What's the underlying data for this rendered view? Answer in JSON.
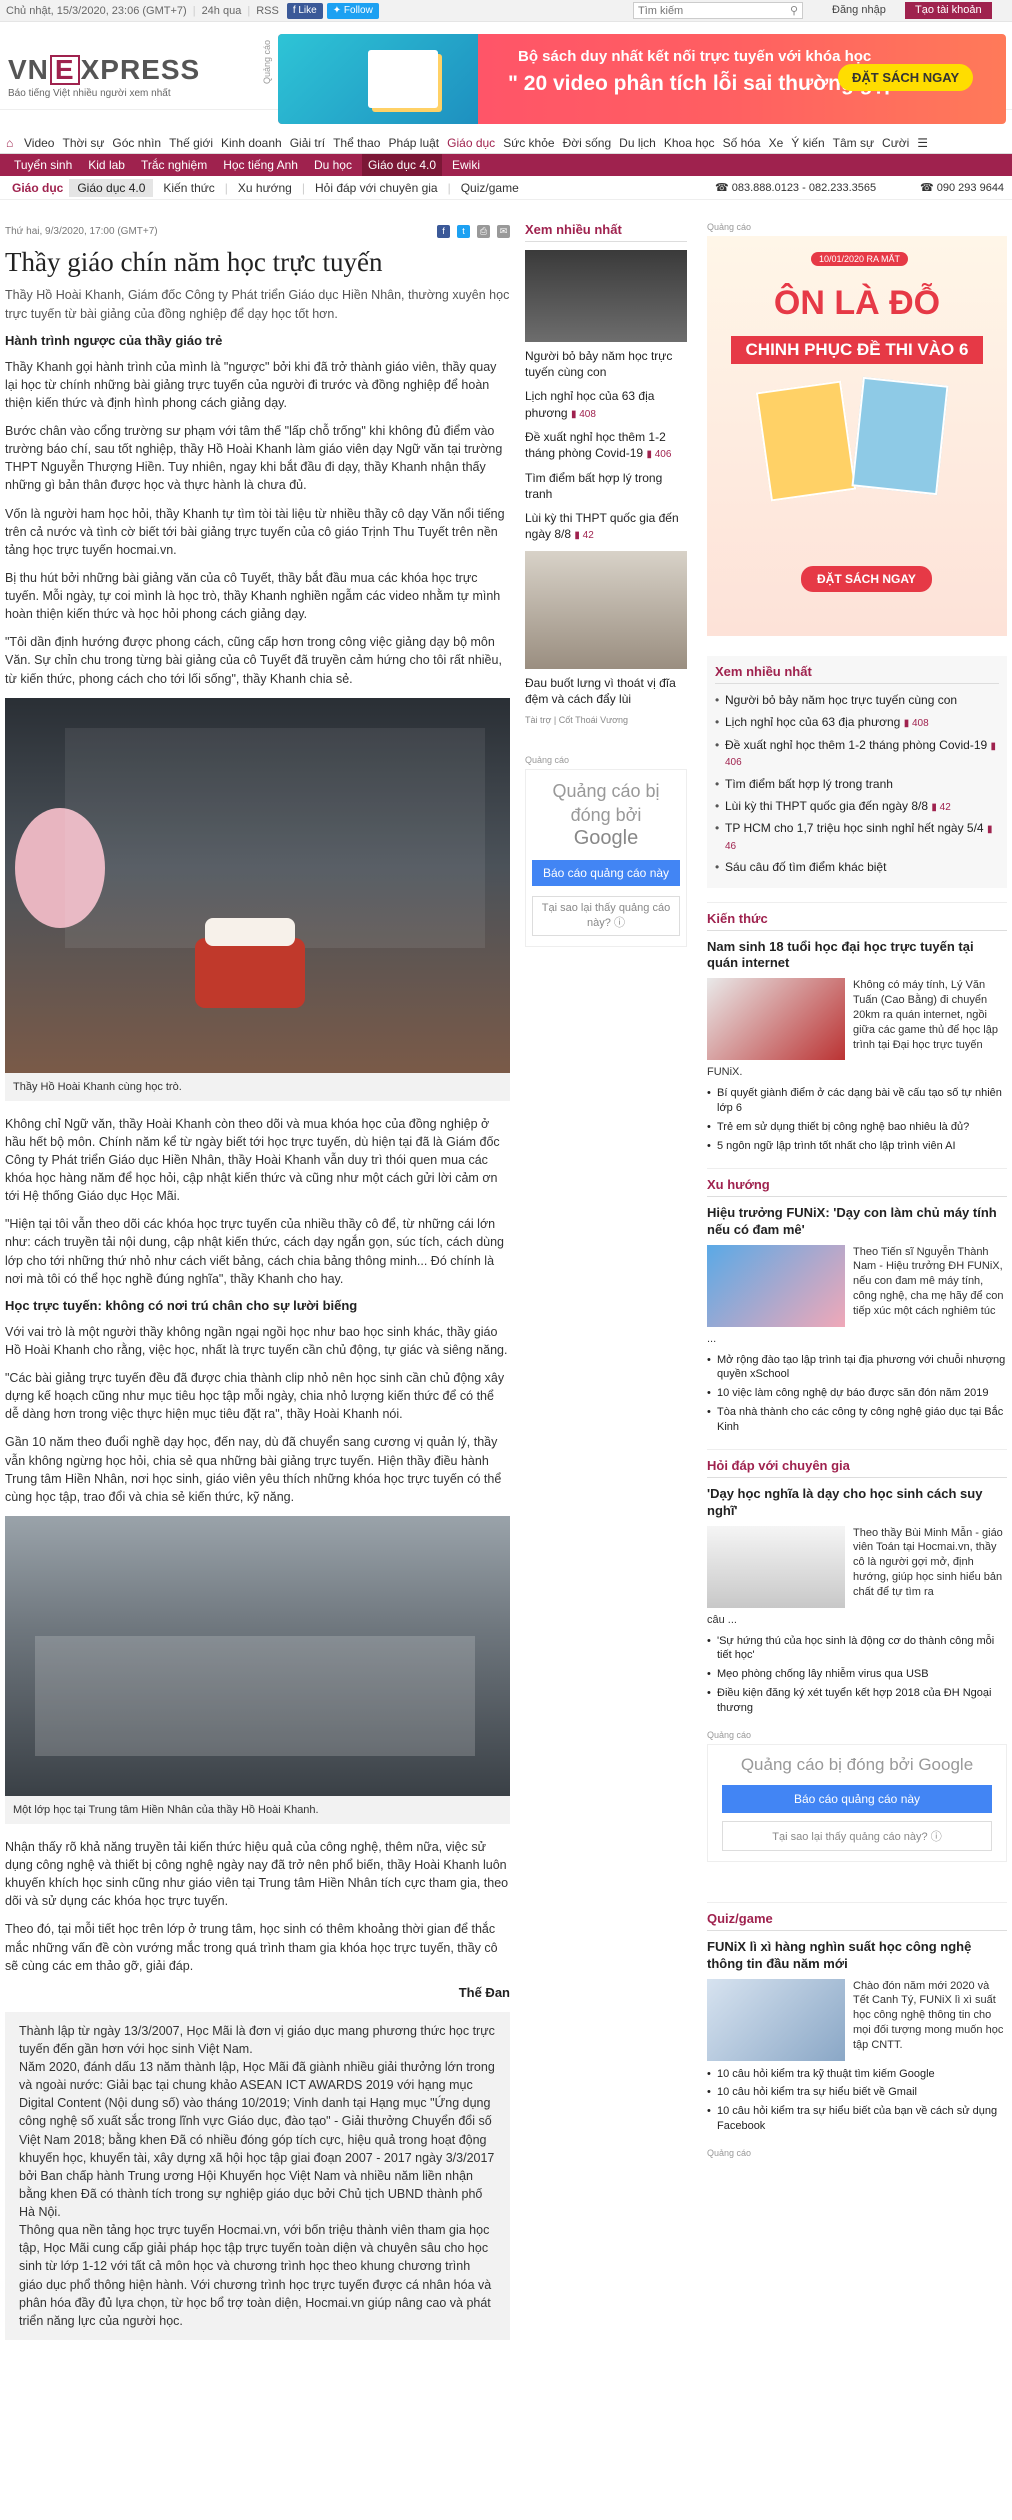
{
  "topbar": {
    "datetime": "Chủ nhật, 15/3/2020, 23:06 (GMT+7)",
    "news24h": "24h qua",
    "rss": "RSS",
    "fb_like": "Like",
    "tw_follow": "Follow",
    "search_placeholder": "Tìm kiếm",
    "login": "Đăng nhập",
    "register": "Tạo tài khoản"
  },
  "header": {
    "logo_left": "VN",
    "logo_e": "E",
    "logo_right": "XPRESS",
    "slogan": "Báo tiếng Việt nhiều người xem nhất",
    "ad_label": "Quảng cáo",
    "banner_line1": "Bộ sách duy nhất kết nối trực tuyến với khóa học",
    "banner_line2": "\" 20 video phân tích lỗi sai thường gặp\"",
    "banner_cta": "ĐẶT SÁCH NGAY"
  },
  "nav": {
    "items": [
      "Video",
      "Thời sự",
      "Góc nhìn",
      "Thế giới",
      "Kinh doanh",
      "Giải trí",
      "Thể thao",
      "Pháp luật",
      "Giáo dục",
      "Sức khỏe",
      "Đời sống",
      "Du lịch",
      "Khoa học",
      "Số hóa",
      "Xe",
      "Ý kiến",
      "Tâm sự",
      "Cười"
    ],
    "active": "Giáo dục"
  },
  "subnav": {
    "items": [
      "Tuyển sinh",
      "Kid lab",
      "Trắc nghiệm",
      "Học tiếng Anh",
      "Du học",
      "Giáo dục 4.0",
      "Ewiki"
    ],
    "active": "Giáo dục 4.0"
  },
  "crumb": {
    "section": "Giáo dục",
    "current": "Giáo dục 4.0",
    "links": [
      "Kiến thức",
      "Xu hướng",
      "Hỏi đáp với chuyên gia",
      "Quiz/game"
    ],
    "hotline": "083.888.0123 - 082.233.3565",
    "hotline2": "090 293 9644"
  },
  "article": {
    "date": "Thứ hai, 9/3/2020, 17:00 (GMT+7)",
    "title": "Thầy giáo chín năm học trực tuyến",
    "lead": "Thầy Hồ Hoài Khanh, Giám đốc Công ty Phát triển Giáo dục Hiền Nhân, thường xuyên học trực tuyến từ bài giảng của đồng nghiệp để dạy học tốt hơn.",
    "h1": "Hành trình ngược của thầy giáo trẻ",
    "p1": "Thầy Khanh gọi hành trình của mình là \"ngược\" bởi khi đã trở thành giáo viên, thầy quay lại học từ chính những bài giảng trực tuyến của người đi trước và đồng nghiệp để hoàn thiện kiến thức và định hình phong cách giảng dạy.",
    "p2": "Bước chân vào cổng trường sư phạm với tâm thế \"lấp chỗ trống\" khi không đủ điểm vào trường báo chí, sau tốt nghiệp, thầy Hồ Hoài Khanh làm giáo viên dạy Ngữ văn tại trường THPT Nguyễn Thượng Hiền. Tuy nhiên, ngay khi bắt đầu đi dạy, thầy Khanh nhận thấy những gì bản thân được học và thực hành là chưa đủ.",
    "p3": "Vốn là người ham học hỏi, thầy Khanh tự tìm tòi tài liệu từ nhiều thầy cô dạy Văn nổi tiếng trên cả nước và tình cờ biết tới bài giảng trực tuyến của cô giáo Trịnh Thu Tuyết trên nền tảng học trực tuyến hocmai.vn.",
    "p4": "Bị thu hút bởi những bài giảng văn của cô Tuyết, thầy bắt đầu mua các khóa học trực tuyến. Mỗi ngày, tự coi mình là học trò, thầy Khanh nghiền ngẫm các video nhằm tự mình hoàn thiện kiến thức và học hỏi phong cách giảng dạy.",
    "p5": "\"Tôi dần định hướng được phong cách, cũng cấp hơn trong công việc giảng dạy bộ môn Văn. Sự chỉn chu trong từng bài giảng của cô Tuyết đã truyền cảm hứng cho tôi rất nhiều, từ kiến thức, phong cách cho tới lối sống\", thầy Khanh chia sẻ.",
    "img1_caption": "Thầy Hồ Hoài Khanh cùng học trò.",
    "p6": "Không chỉ Ngữ văn, thầy Hoài Khanh còn theo dõi và mua khóa học của đồng nghiệp ở hầu hết bộ môn. Chính năm kể từ ngày biết tới học trực tuyến, dù hiện tại đã là Giám đốc Công ty Phát triển Giáo dục Hiền Nhân, thầy Hoài Khanh vẫn duy trì thói quen mua các khóa học hàng năm để học hỏi, cập nhật kiến thức và cũng như một cách gửi lời cảm ơn tới Hệ thống Giáo dục Học Mãi.",
    "p7": "\"Hiện tại tôi vẫn theo dõi các khóa học trực tuyến của nhiều thầy cô để, từ những cái lớn như: cách truyền tải nội dung, cập nhật kiến thức, cách dạy ngắn gọn, súc tích, cách dùng lớp cho tới những thứ nhỏ như cách viết bảng, cách chia bảng thông minh... Đó chính là nơi mà tôi có thể học nghề đúng nghĩa\", thầy Khanh cho hay.",
    "h2": "Học trực tuyến: không có nơi trú chân cho sự lười biếng",
    "p8": "Với vai trò là một người thầy không ngần ngại ngồi học như bao học sinh khác, thầy giáo Hồ Hoài Khanh cho rằng, việc học, nhất là trực tuyến cần chủ động, tự giác và siêng năng.",
    "p9": "\"Các bài giảng trực tuyến đều đã được chia thành clip nhỏ nên học sinh cần chủ động xây dựng kế hoạch cũng như mục tiêu học tập mỗi ngày, chia nhỏ lượng kiến thức để có thể dễ dàng hơn trong việc thực hiện mục tiêu đặt ra\", thầy Hoài Khanh nói.",
    "p10": "Gần 10 năm theo đuổi nghề dạy học, đến nay, dù đã chuyển sang cương vị quản lý, thầy vẫn không ngừng học hỏi, chia sẻ qua những bài giảng trực tuyến. Hiện thầy điều hành Trung tâm Hiền Nhân, nơi học sinh, giáo viên yêu thích những khóa học trực tuyến có thể cùng học tập, trao đổi và chia sẻ kiến thức, kỹ năng.",
    "img2_caption": "Một lớp học tại Trung tâm Hiền Nhân của thầy Hồ Hoài Khanh.",
    "p11": "Nhận thấy rõ khả năng truyền tải kiến thức hiệu quả của công nghệ, thêm nữa, việc sử dụng công nghệ và thiết bị công nghệ ngày nay đã trở nên phổ biến, thầy Hoài Khanh luôn khuyến khích học sinh cũng như giáo viên tại Trung tâm Hiền Nhân tích cực tham gia, theo dõi và sử dụng các khóa học trực tuyến.",
    "p12": "Theo đó, tại mỗi tiết học trên lớp ở trung tâm, học sinh có thêm khoảng thời gian để thắc mắc những vấn đề còn vướng mắc trong quá trình tham gia khóa học trực tuyến, thầy cô sẽ cùng các em thảo gỡ, giải đáp.",
    "author": "Thế Đan",
    "box": "Thành lập từ ngày 13/3/2007, Học Mãi là đơn vị giáo dục mang phương thức học trực tuyến đến gần hơn với học sinh Việt Nam.\nNăm 2020, đánh dấu 13 năm thành lập, Học Mãi đã giành nhiều giải thưởng lớn trong và ngoài nước: Giải bạc tại chung khảo ASEAN ICT AWARDS 2019 với hạng mục Digital Content (Nội dung số) vào tháng 10/2019; Vinh danh tại Hạng mục \"Ứng dụng công nghệ số xuất sắc trong lĩnh vực Giáo dục, đào tạo\" - Giải thưởng Chuyển đổi số Việt Nam 2018; bằng khen Đã có nhiều đóng góp tích cực, hiệu quả trong hoạt động khuyến học, khuyến tài, xây dựng xã hội học tập giai đoạn 2007 - 2017 ngày 3/3/2017 bởi Ban chấp hành Trung ương Hội Khuyến học Việt Nam và nhiều năm liền nhận bằng khen Đã có thành tích trong sự nghiệp giáo dục bởi Chủ tịch UBND thành phố Hà Nội.\nThông qua nền tảng học trực tuyến Hocmai.vn, với bốn triệu thành viên tham gia học tập, Học Mãi cung cấp giải pháp học tập trực tuyến toàn diện và chuyên sâu cho học sinh từ lớp 1-12 với tất cả môn học và chương trình học theo khung chương trình giáo dục phổ thông hiện hành. Với chương trình học trực tuyến được cá nhân hóa và phân hóa đầy đủ lựa chọn, từ học bổ trợ toàn diện, Hocmai.vn giúp nâng cao và phát triển năng lực của người học."
  },
  "middle": {
    "section": "Xem nhiều nhất",
    "links": [
      {
        "text": "Người bỏ bảy năm học trực tuyến cùng con",
        "comments": ""
      },
      {
        "text": "Lịch nghỉ học của 63 địa phương",
        "comments": "408"
      },
      {
        "text": "Đề xuất nghỉ học thêm 1-2 tháng phòng Covid-19",
        "comments": "406"
      },
      {
        "text": "Tìm điểm bất hợp lý trong tranh",
        "comments": ""
      },
      {
        "text": "Lùi kỳ thi THPT quốc gia đến ngày 8/8",
        "comments": "42"
      }
    ],
    "photo2_caption": "Đau buốt lưng vì thoát vị đĩa đệm và cách đẩy lùi",
    "photo2_source": "Tài trợ | Cốt Thoái Vương",
    "ad_label": "Quảng cáo",
    "ad_text": "Quảng cáo bị đóng bởi",
    "ad_brand": "Google",
    "ad_report": "Báo cáo quảng cáo này",
    "ad_why": "Tại sao lại thấy quảng cáo này?"
  },
  "right": {
    "ad_label": "Quảng cáo",
    "promo_date": "10/01/2020 RA MẮT",
    "promo_title": "ÔN LÀ ĐỖ",
    "promo_sub": "CHINH PHỤC ĐỀ THI VÀO 6",
    "promo_cta": "ĐẶT SÁCH NGAY",
    "most_viewed_title": "Xem nhiều nhất",
    "most_viewed": [
      {
        "text": "Người bỏ bảy năm học trực tuyến cùng con",
        "comments": ""
      },
      {
        "text": "Lịch nghỉ học của 63 địa phương",
        "comments": "408"
      },
      {
        "text": "Đề xuất nghỉ học thêm 1-2 tháng phòng Covid-19",
        "comments": "406"
      },
      {
        "text": "Tìm điểm bất hợp lý trong tranh",
        "comments": ""
      },
      {
        "text": "Lùi kỳ thi THPT quốc gia đến ngày 8/8",
        "comments": "42"
      },
      {
        "text": "TP HCM cho 1,7 triệu học sinh nghỉ hết ngày 5/4",
        "comments": "46"
      },
      {
        "text": "Sáu câu đố tìm điểm khác biệt",
        "comments": ""
      }
    ],
    "kienthuc_title": "Kiến thức",
    "kienthuc_head": "Nam sinh 18 tuổi học đại học trực tuyến tại quán internet",
    "kienthuc_desc": "Không có máy tính, Lý Văn Tuấn (Cao Bằng) đi chuyển 20km ra quán internet, ngồi giữa các game thủ để học lập trình tại Đại học trực tuyến",
    "kienthuc_cont": "FUNiX.",
    "kienthuc_list": [
      "Bí quyết giành điểm ở các dạng bài về cấu tạo số tự nhiên lớp 6",
      "Trẻ em sử dụng thiết bị công nghệ bao nhiêu là đủ?",
      "5 ngôn ngữ lập trình tốt nhất cho lập trình viên AI"
    ],
    "xuhuong_title": "Xu hướng",
    "xuhuong_head": "Hiệu trưởng FUNiX: 'Dạy con làm chủ máy tính nếu có đam mê'",
    "xuhuong_desc": "Theo Tiến sĩ Nguyễn Thành Nam - Hiệu trưởng ĐH FUNiX, nếu con đam mê máy tính, công nghệ, cha mẹ hãy để con tiếp xúc một cách nghiêm túc",
    "xuhuong_cont": "...",
    "xuhuong_list": [
      "Mở rộng đào tạo lập trình tại địa phương với chuỗi nhượng quyền xSchool",
      "10 việc làm công nghệ dự báo được săn đón năm 2019",
      "Tòa nhà thành cho các công ty công nghệ giáo dục tại Bắc Kinh"
    ],
    "hoidap_title": "Hỏi đáp với chuyên gia",
    "hoidap_head": "'Dạy học nghĩa là dạy cho học sinh cách suy nghĩ'",
    "hoidap_desc": "Theo thầy Bùi Minh Mẫn - giáo viên Toán tại Hocmai.vn, thầy cô là người gợi mở, định hướng, giúp học sinh hiểu bản chất để tự tìm ra",
    "hoidap_cont": "câu ...",
    "hoidap_list": [
      "'Sự hứng thú của học sinh là động cơ do thành công mỗi tiết học'",
      "Mẹo phòng chống lây nhiễm virus qua USB",
      "Điều kiện đăng ký xét tuyển kết hợp 2018 của ĐH Ngoại thương"
    ],
    "gad_label": "Quảng cáo",
    "gad_text": "Quảng cáo bị đóng bởi Google",
    "gad_report": "Báo cáo quảng cáo này",
    "gad_why": "Tại sao lại thấy quảng cáo này?",
    "quiz_title": "Quiz/game",
    "quiz_head": "FUNiX lì xì hàng nghìn suất học công nghệ thông tin đầu năm mới",
    "quiz_desc": "Chào đón năm mới 2020 và Tết Canh Tý, FUNiX lì xì suất học công nghệ thông tin cho mọi đối tượng mong muốn học tập CNTT.",
    "quiz_list": [
      "10 câu hỏi kiểm tra kỹ thuật tìm kiếm Google",
      "10 câu hỏi kiểm tra sự hiểu biết về Gmail",
      "10 câu hỏi kiểm tra sự hiểu biết của bạn về cách sử dụng Facebook"
    ],
    "bottom_ad_label": "Quảng cáo"
  }
}
